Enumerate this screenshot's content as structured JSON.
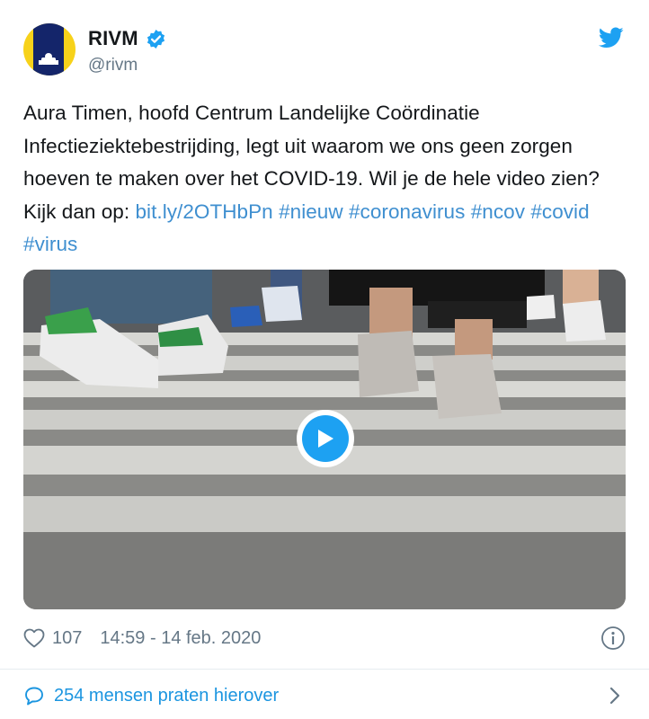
{
  "account": {
    "name": "RIVM",
    "handle": "@rivm",
    "verified_icon": "verified-badge-icon",
    "brand_color": "#1da1f2"
  },
  "tweet": {
    "text": "Aura Timen, hoofd Centrum Landelijke Coördinatie Infectieziektebestrijding, legt uit waarom we ons geen zorgen hoeven te maken over het COVID-19. Wil je de hele video zien? Kijk dan op: ",
    "link": "bit.ly/2OTHbPn",
    "hashtags": [
      "#nieuw",
      "#coronavirus",
      "#ncov",
      "#covid",
      "#virus"
    ]
  },
  "media": {
    "type": "video",
    "play_icon": "play-icon"
  },
  "meta": {
    "likes": "107",
    "timestamp": "14:59 - 14 feb. 2020",
    "heart_icon": "heart-icon",
    "info_icon": "info-icon"
  },
  "footer": {
    "talk_label": "254 mensen praten hierover",
    "chevron_icon": "chevron-right-icon"
  },
  "colors": {
    "text": "#14171a",
    "secondary": "#657786",
    "link": "#3f8fd0",
    "accent": "#1b95e0",
    "divider": "#e6ecf0",
    "avatar_yellow": "#f7d21a",
    "avatar_navy": "#14256a"
  }
}
